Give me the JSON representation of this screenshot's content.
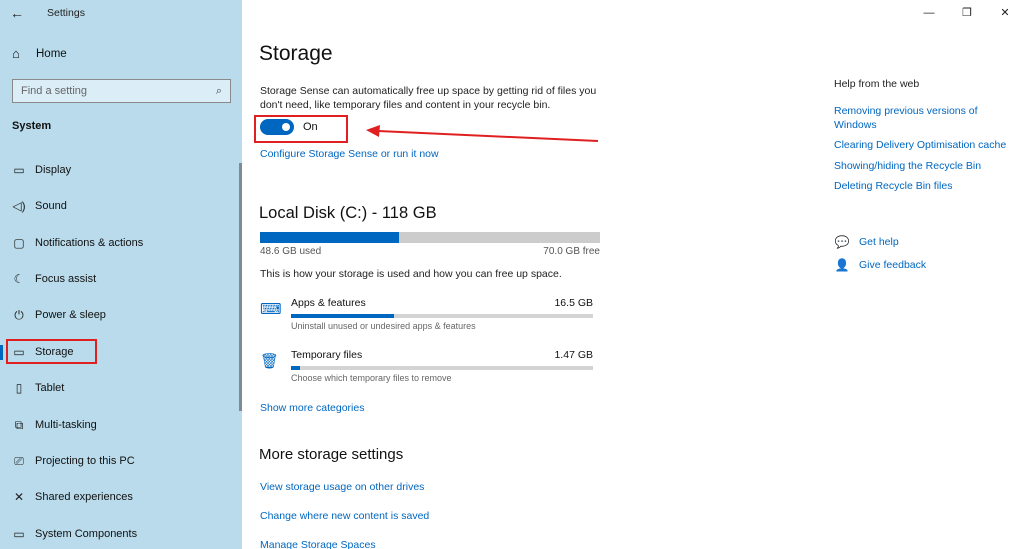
{
  "window": {
    "app_title": "Settings",
    "back_icon": "back-arrow-icon",
    "controls": [
      "minimize-icon",
      "restore-icon",
      "close-icon"
    ],
    "minimize_glyph": "—",
    "restore_glyph": "❐",
    "close_glyph": "✕"
  },
  "sidebar": {
    "home_label": "Home",
    "search": {
      "placeholder": "Find a setting"
    },
    "section_title": "System",
    "items": [
      {
        "label": "Display",
        "icon": "display-icon",
        "glyph": "▭"
      },
      {
        "label": "Sound",
        "icon": "sound-icon",
        "glyph": "🔉"
      },
      {
        "label": "Notifications & actions",
        "icon": "notifications-icon",
        "glyph": "▢"
      },
      {
        "label": "Focus assist",
        "icon": "focus-assist-icon",
        "glyph": "☾"
      },
      {
        "label": "Power & sleep",
        "icon": "power-icon",
        "glyph": "⏻"
      },
      {
        "label": "Storage",
        "icon": "storage-icon",
        "glyph": "▭",
        "active": true
      },
      {
        "label": "Tablet",
        "icon": "tablet-icon",
        "glyph": "▯"
      },
      {
        "label": "Multi-tasking",
        "icon": "multitasking-icon",
        "glyph": "⧉"
      },
      {
        "label": "Projecting to this PC",
        "icon": "projecting-icon",
        "glyph": "⎚"
      },
      {
        "label": "Shared experiences",
        "icon": "shared-experiences-icon",
        "glyph": "✕"
      },
      {
        "label": "System Components",
        "icon": "system-components-icon",
        "glyph": "▭"
      }
    ]
  },
  "main": {
    "title": "Storage",
    "storage_sense_desc": "Storage Sense can automatically free up space by getting rid of files you don't need, like temporary files and content in your recycle bin.",
    "toggle": {
      "state_label": "On",
      "on": true
    },
    "configure_link": "Configure Storage Sense or run it now",
    "disk": {
      "title": "Local Disk (C:) - 118 GB",
      "used_label": "48.6 GB used",
      "free_label": "70.0 GB free",
      "used_fraction": 0.41
    },
    "usage_desc": "This is how your storage is used and how you can free up space.",
    "categories": [
      {
        "name": "Apps & features",
        "size": "16.5 GB",
        "sub": "Uninstall unused or undesired apps & features",
        "icon": "apps-features-icon",
        "glyph": "⌨",
        "fraction": 0.34
      },
      {
        "name": "Temporary files",
        "size": "1.47 GB",
        "sub": "Choose which temporary files to remove",
        "icon": "trash-icon",
        "glyph": "🗑",
        "fraction": 0.03
      }
    ],
    "show_more_link": "Show more categories",
    "more_title": "More storage settings",
    "more_links": [
      "View storage usage on other drives",
      "Change where new content is saved",
      "Manage Storage Spaces"
    ]
  },
  "help": {
    "title": "Help from the web",
    "links": [
      "Removing previous versions of Windows",
      "Clearing Delivery Optimisation cache",
      "Showing/hiding the Recycle Bin",
      "Deleting Recycle Bin files"
    ],
    "get_help": "Get help",
    "give_feedback": "Give feedback"
  },
  "colors": {
    "accent": "#0067c0",
    "sidebar_bg": "#b9dbec",
    "annotation_red": "#e02020"
  }
}
